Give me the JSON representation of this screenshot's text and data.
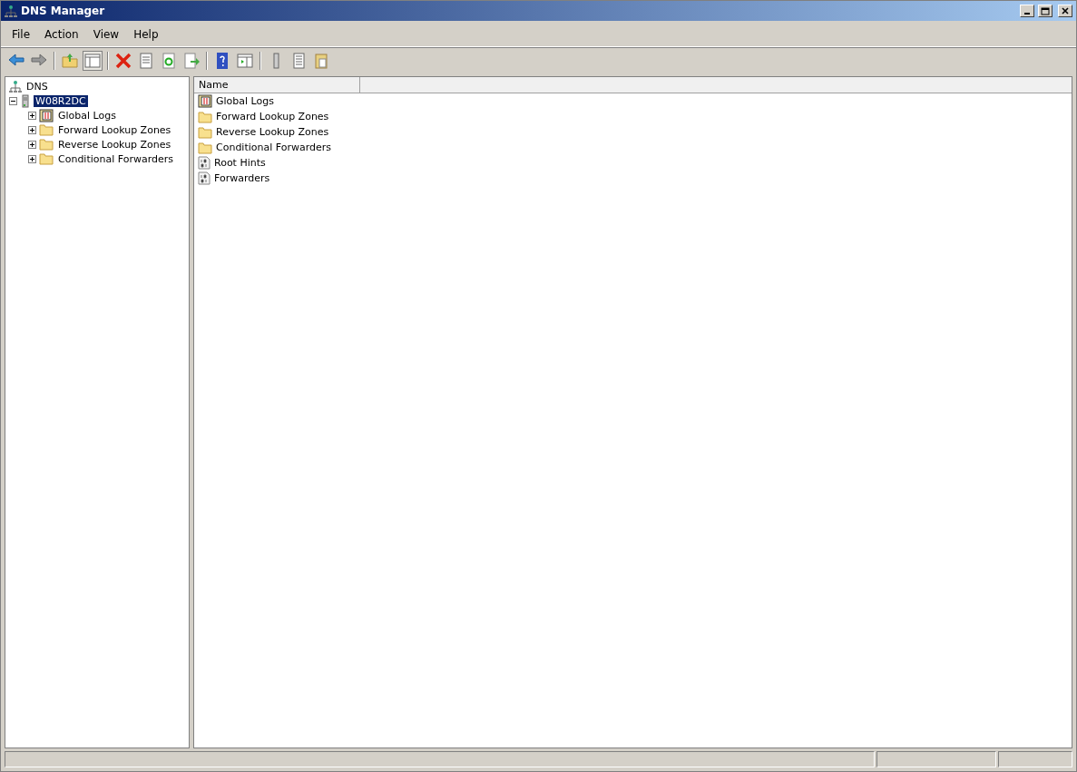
{
  "window": {
    "title": "DNS Manager"
  },
  "menu": [
    "File",
    "Action",
    "View",
    "Help"
  ],
  "tree": [
    {
      "label": "DNS",
      "kind": "dns",
      "selected": false,
      "children": [
        {
          "label": "W08R2DC",
          "kind": "server",
          "selected": true,
          "expanded": true,
          "children": [
            {
              "label": "Global Logs",
              "kind": "logs",
              "selected": false,
              "expanded": false
            },
            {
              "label": "Forward Lookup Zones",
              "kind": "folder",
              "selected": false,
              "expanded": false
            },
            {
              "label": "Reverse Lookup Zones",
              "kind": "folder",
              "selected": false,
              "expanded": false
            },
            {
              "label": "Conditional Forwarders",
              "kind": "folder",
              "selected": false,
              "expanded": false
            }
          ]
        }
      ]
    }
  ],
  "table": {
    "columns": [
      "Name"
    ],
    "rows": [
      {
        "name": "Global Logs",
        "kind": "logs"
      },
      {
        "name": "Forward Lookup Zones",
        "kind": "folder"
      },
      {
        "name": "Reverse Lookup Zones",
        "kind": "folder"
      },
      {
        "name": "Conditional Forwarders",
        "kind": "folder"
      },
      {
        "name": "Root Hints",
        "kind": "file"
      },
      {
        "name": "Forwarders",
        "kind": "file"
      }
    ]
  }
}
